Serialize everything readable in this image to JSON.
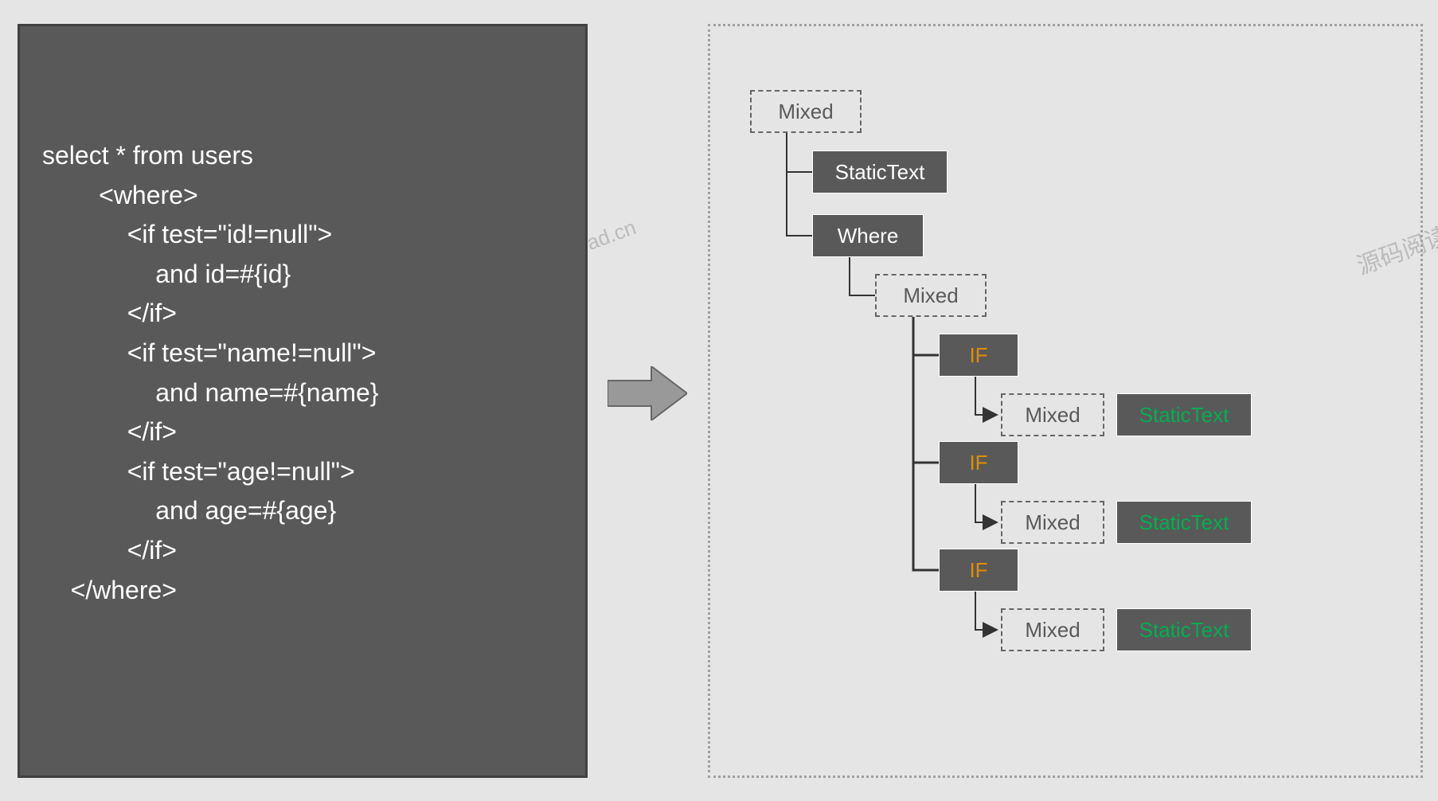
{
  "code": {
    "line1": "select * from users",
    "line2": "        <where>",
    "line3": "            <if test=\"id!=null\">",
    "line4": "                and id=#{id}",
    "line5": "            </if>",
    "line6": "            <if test=\"name!=null\">",
    "line7": "                and name=#{name}",
    "line8": "            </if>",
    "line9": "            <if test=\"age!=null\">",
    "line10": "                and age=#{age}",
    "line11": "            </if>",
    "line12": "    </where>"
  },
  "tree": {
    "root_mixed": "Mixed",
    "static_text": "StaticText",
    "where": "Where",
    "mixed2": "Mixed",
    "if1": "IF",
    "mixed_if1": "Mixed",
    "static_if1": "StaticText",
    "if2": "IF",
    "mixed_if2": "Mixed",
    "static_if2": "StaticText",
    "if3": "IF",
    "mixed_if3": "Mixed",
    "static_if3": "StaticText"
  },
  "watermark": {
    "wm1": "ad.cn",
    "wm2": "源码阅读网"
  }
}
